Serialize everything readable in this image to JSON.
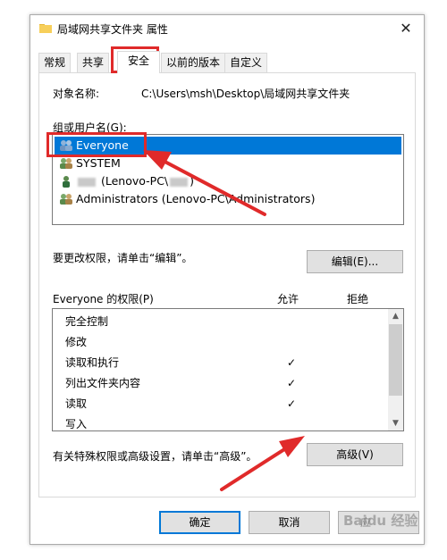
{
  "window": {
    "title": "局域网共享文件夹 属性",
    "close": "✕"
  },
  "tabs": [
    {
      "label": "常规"
    },
    {
      "label": "共享"
    },
    {
      "label": "安全"
    },
    {
      "label": "以前的版本"
    },
    {
      "label": "自定义"
    }
  ],
  "security": {
    "object_name_label": "对象名称:",
    "object_name_value": "C:\\Users\\msh\\Desktop\\局域网共享文件夹",
    "groups_label": "组或用户名(G):",
    "groups": [
      {
        "name": "Everyone",
        "selected": true
      },
      {
        "name": "SYSTEM",
        "selected": false
      },
      {
        "name_suffix": "(Lenovo-PC\\",
        "selected": false
      },
      {
        "name": "Administrators (Lenovo-PC\\Administrators)",
        "selected": false
      }
    ],
    "change_hint": "要更改权限，请单击“编辑”。",
    "edit_button": "编辑(E)...",
    "perm_header": "Everyone 的权限(P)",
    "allow_header": "允许",
    "deny_header": "拒绝",
    "permissions": [
      {
        "name": "完全控制",
        "allow": ""
      },
      {
        "name": "修改",
        "allow": ""
      },
      {
        "name": "读取和执行",
        "allow": "✓"
      },
      {
        "name": "列出文件夹内容",
        "allow": "✓"
      },
      {
        "name": "读取",
        "allow": "✓"
      },
      {
        "name": "写入",
        "allow": ""
      }
    ],
    "advanced_hint": "有关特殊权限或高级设置，请单击“高级”。",
    "advanced_button": "高级(V)"
  },
  "footer": {
    "ok": "确定",
    "cancel": "取消",
    "apply": "应"
  },
  "watermark": "Baidu 经验",
  "colors": {
    "selection": "#0078d7",
    "highlight_red": "#e02a2a"
  }
}
